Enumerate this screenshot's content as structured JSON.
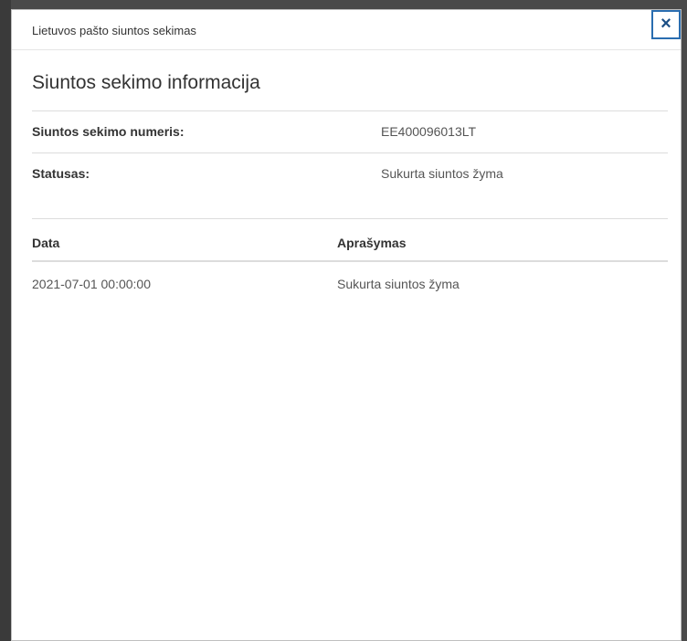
{
  "modal": {
    "title": "Lietuvos pašto siuntos sekimas",
    "close_label": "×",
    "heading": "Siuntos sekimo informacija"
  },
  "info": [
    {
      "label": "Siuntos sekimo numeris:",
      "value": "EE400096013LT"
    },
    {
      "label": "Statusas:",
      "value": "Sukurta siuntos žyma"
    }
  ],
  "events": {
    "headers": {
      "date": "Data",
      "description": "Aprašymas"
    },
    "rows": [
      {
        "date": "2021-07-01 00:00:00",
        "description": "Sukurta siuntos žyma"
      }
    ]
  },
  "colors": {
    "backdrop": "#4a4a4a",
    "close_border": "#2a6db0",
    "divider": "#dcdcdc"
  },
  "icons": {
    "close": "close-icon"
  }
}
